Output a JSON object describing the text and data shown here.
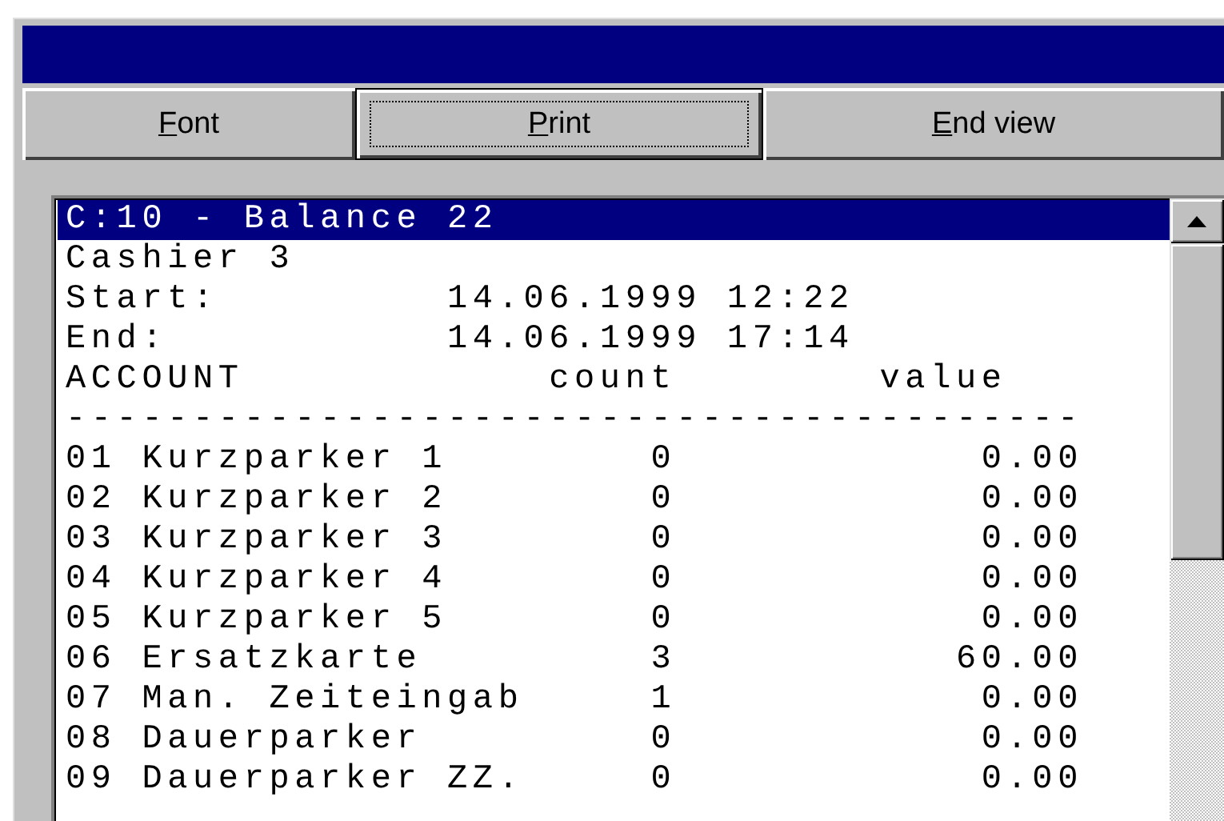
{
  "buttons": [
    {
      "label": "Font",
      "focused": false
    },
    {
      "label": "Print",
      "focused": true
    },
    {
      "label": "End view",
      "focused": false
    }
  ],
  "listing": {
    "title": "C:10 - Balance 22",
    "title_selected": true,
    "cashier": "Cashier 3",
    "period": [
      {
        "label": "Start:",
        "value": "14.06.1999 12:22"
      },
      {
        "label": "End:",
        "value": "14.06.1999 17:14"
      }
    ],
    "columns": [
      "ACCOUNT",
      "count",
      "value"
    ],
    "separator": "----------------------------------------",
    "rows": [
      {
        "account": "01 Kurzparker 1",
        "count": "0",
        "value": "0.00"
      },
      {
        "account": "02 Kurzparker 2",
        "count": "0",
        "value": "0.00"
      },
      {
        "account": "03 Kurzparker 3",
        "count": "0",
        "value": "0.00"
      },
      {
        "account": "04 Kurzparker 4",
        "count": "0",
        "value": "0.00"
      },
      {
        "account": "05 Kurzparker 5",
        "count": "0",
        "value": "0.00"
      },
      {
        "account": "06 Ersatzkarte",
        "count": "3",
        "value": "60.00"
      },
      {
        "account": "07 Man. Zeiteingab",
        "count": "1",
        "value": "0.00"
      },
      {
        "account": "08 Dauerparker",
        "count": "0",
        "value": "0.00"
      },
      {
        "account": "09 Dauerparker ZZ.",
        "count": "0",
        "value": "0.00"
      }
    ]
  }
}
